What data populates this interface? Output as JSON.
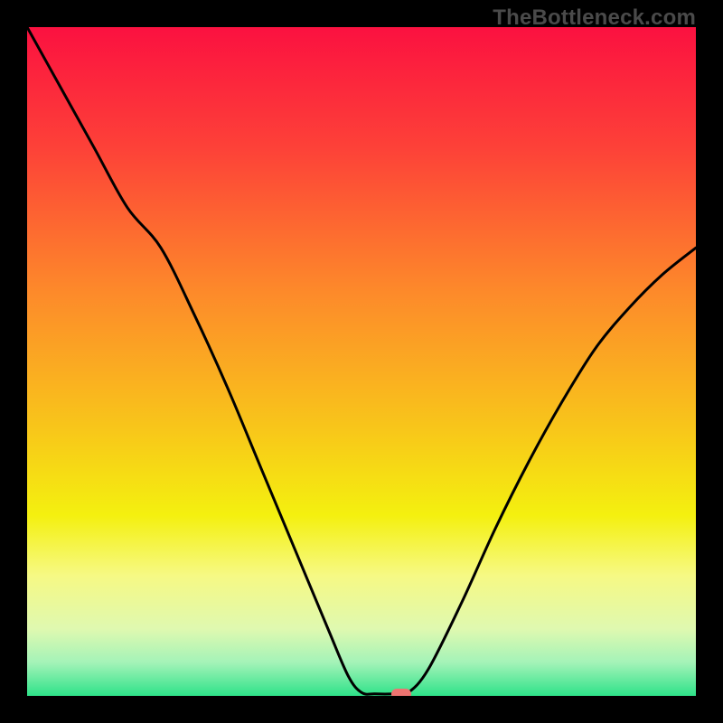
{
  "watermark": "TheBottleneck.com",
  "marker": {
    "color": "#ed7471"
  },
  "colors": {
    "gradient_stops": [
      {
        "pct": 0,
        "color": "#fb1140"
      },
      {
        "pct": 18,
        "color": "#fd4138"
      },
      {
        "pct": 40,
        "color": "#fd8b2a"
      },
      {
        "pct": 60,
        "color": "#f8c61a"
      },
      {
        "pct": 73,
        "color": "#f4f00f"
      },
      {
        "pct": 82,
        "color": "#f6f984"
      },
      {
        "pct": 90,
        "color": "#dff9b0"
      },
      {
        "pct": 95,
        "color": "#a4f3b8"
      },
      {
        "pct": 100,
        "color": "#2ee289"
      }
    ],
    "curve": "#000000"
  },
  "chart_data": {
    "type": "line",
    "title": "",
    "xlabel": "",
    "ylabel": "",
    "xlim": [
      0,
      100
    ],
    "ylim": [
      0,
      100
    ],
    "grid": false,
    "legend": false,
    "x": [
      0,
      5,
      10,
      15,
      20,
      25,
      30,
      35,
      40,
      45,
      48,
      50,
      52,
      55,
      57,
      60,
      65,
      70,
      75,
      80,
      85,
      90,
      95,
      100
    ],
    "values": [
      100,
      91,
      82,
      73,
      67,
      57,
      46,
      34,
      22,
      10,
      3,
      0.5,
      0.3,
      0.3,
      0.5,
      4,
      14,
      25,
      35,
      44,
      52,
      58,
      63,
      67
    ],
    "flat_segment": {
      "x_start": 50,
      "x_end": 57,
      "y": 0.3
    },
    "marker_point": {
      "x": 56,
      "y": 0.3
    }
  }
}
